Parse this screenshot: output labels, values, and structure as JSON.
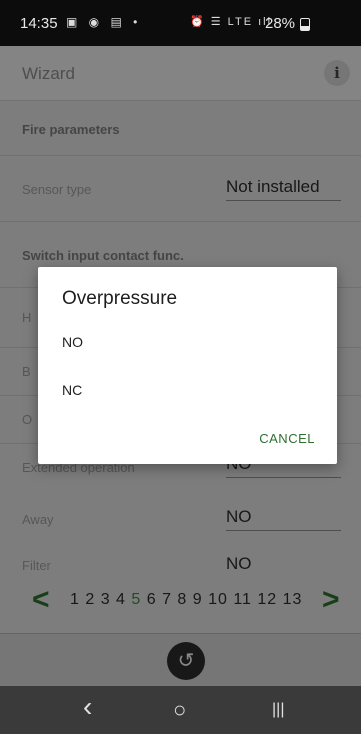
{
  "status_bar": {
    "time": "14:35",
    "left_icons": "▣ ◉ ▤ •",
    "right_icons": "⏰ ☰ LTE ıll",
    "battery_percent": "28%"
  },
  "app": {
    "title": "Wizard",
    "info_icon_glyph": "i",
    "rows": {
      "fire_parameters": "Fire parameters",
      "sensor_type_label": "Sensor type",
      "sensor_type_value": "Not installed",
      "switch_input_label": "Switch input contact func.",
      "obscured_label_1": "H",
      "obscured_label_2": "B",
      "obscured_label_3": "O",
      "extended_operation_label": "Extended operation",
      "extended_operation_value": "NO",
      "away_label": "Away",
      "away_value": "NO",
      "filter_label": "Filter",
      "filter_value": "NO"
    },
    "pager": {
      "prev_glyph": "<",
      "next_glyph": ">",
      "pages_before": "1 2 3 4 ",
      "current_page": "5",
      "pages_after": " 6 7 8 9 10 11 12 13"
    },
    "undo_glyph": "↺"
  },
  "dialog": {
    "title": "Overpressure",
    "options": [
      "NO",
      "NC"
    ],
    "cancel_label": "CANCEL"
  },
  "navbar": {
    "back_glyph": "‹",
    "home_glyph": "○",
    "recents_glyph": "|||"
  },
  "colors": {
    "accent_green": "#2f6f2f",
    "scrim": "rgba(0,0,0,0.43)"
  }
}
